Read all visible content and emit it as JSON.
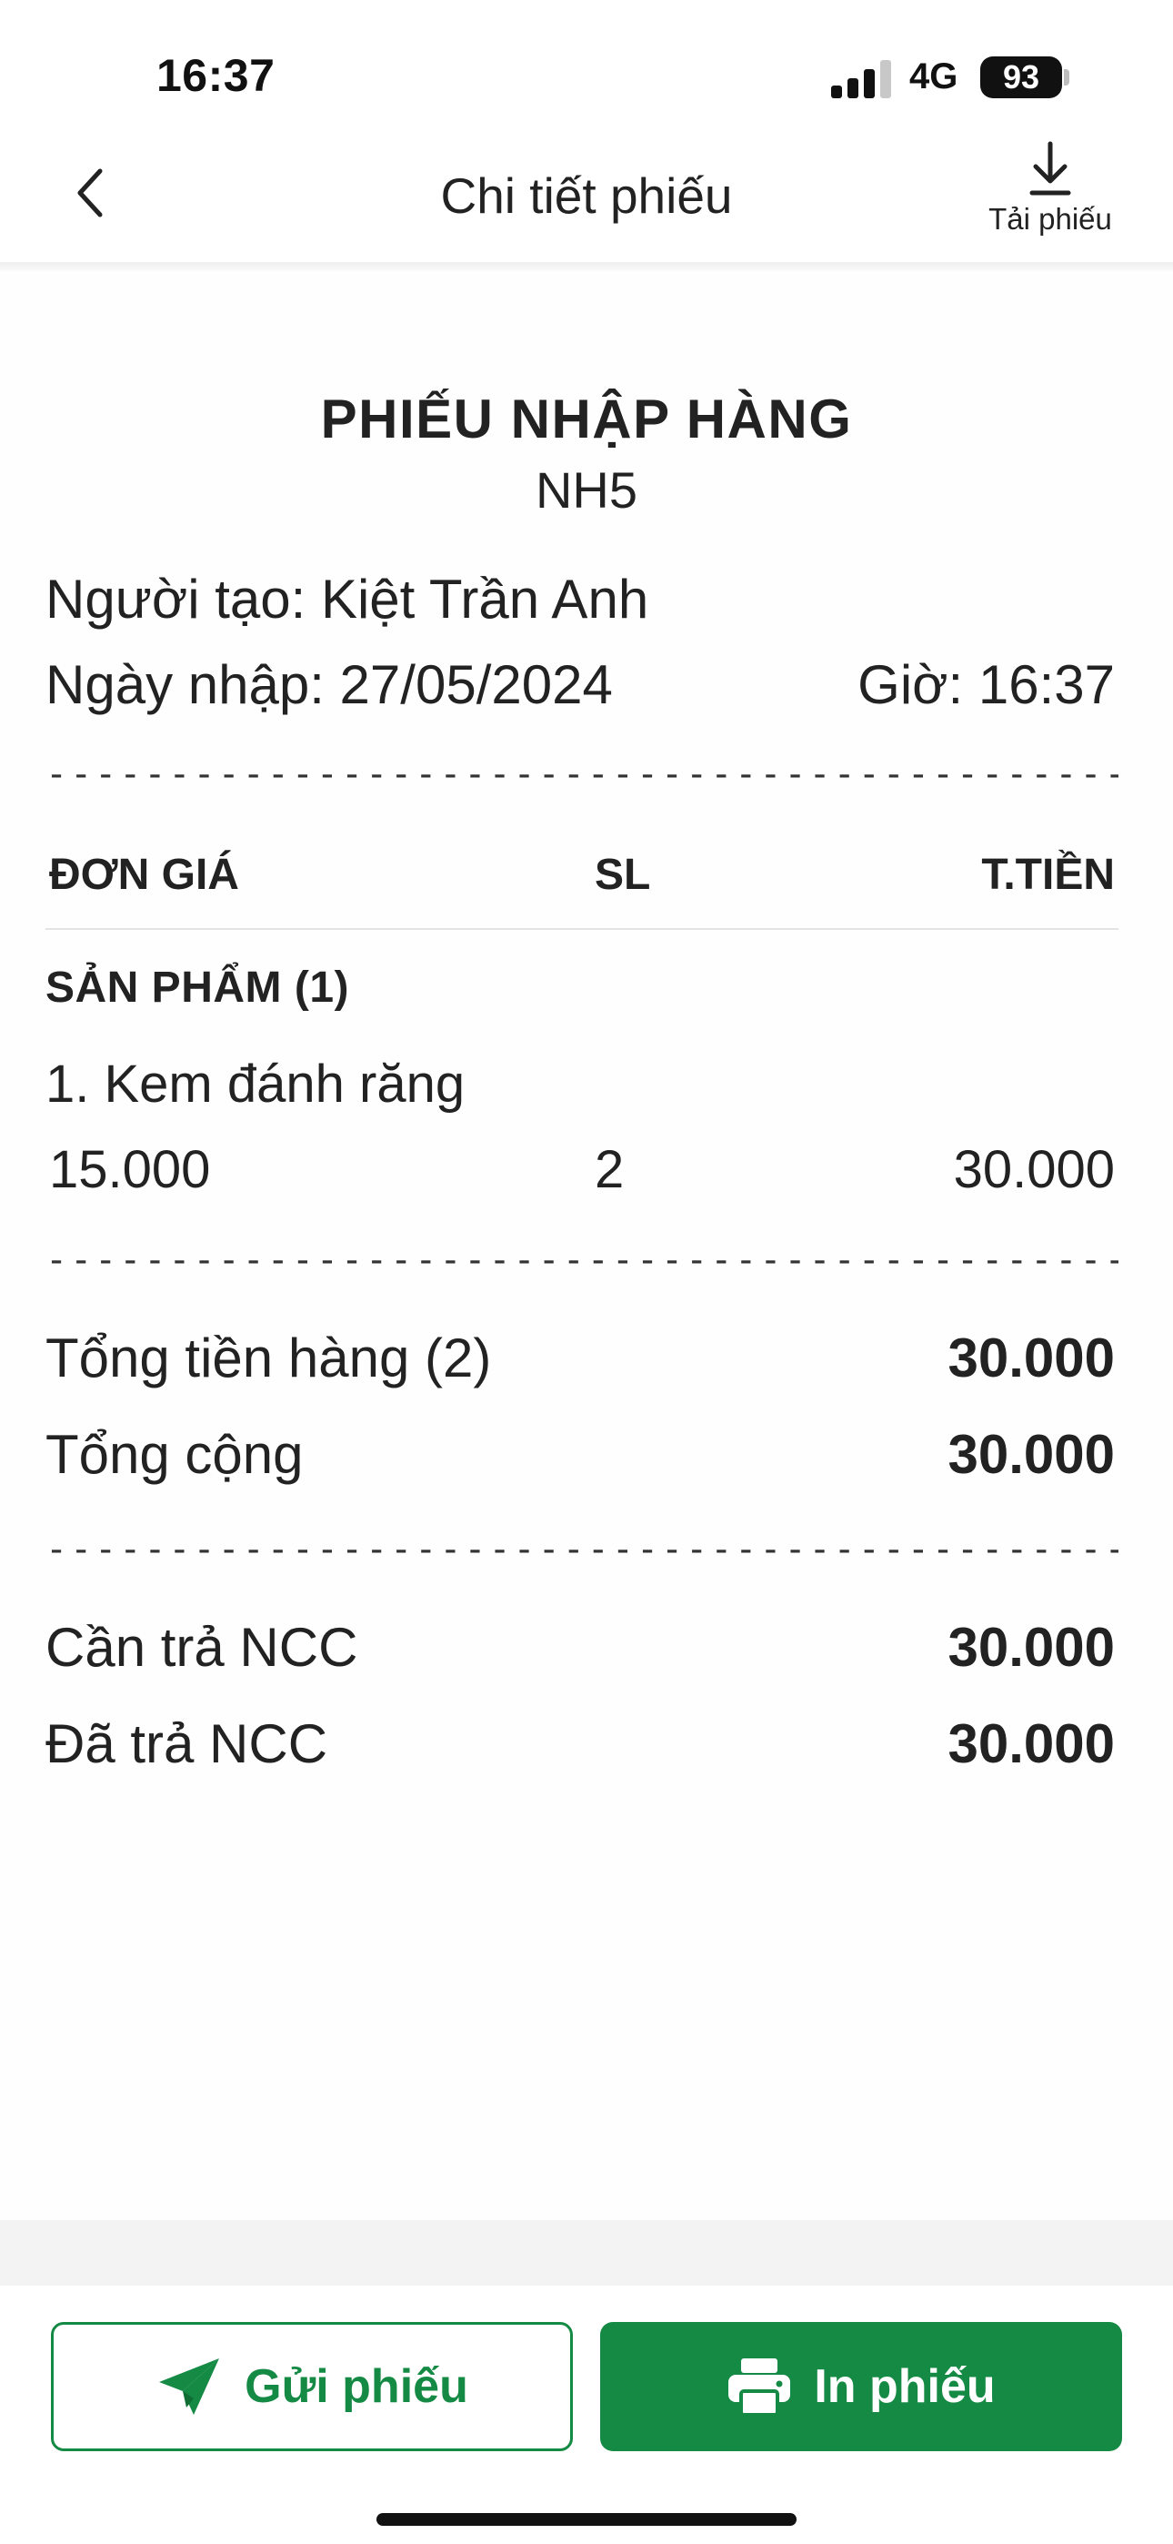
{
  "status_bar": {
    "time": "16:37",
    "network": "4G",
    "battery": "93"
  },
  "nav": {
    "title": "Chi tiết phiếu",
    "download_label": "Tải phiếu",
    "back_icon": "chevron-left-icon",
    "download_icon": "download-icon"
  },
  "receipt": {
    "title": "PHIẾU NHẬP HÀNG",
    "code": "NH5",
    "creator": "Người tạo: Kiệt Trần Anh",
    "date": "Ngày nhập: 27/05/2024",
    "time": "Giờ: 16:37",
    "dashes": "------------------------------------------------------------------",
    "columns": {
      "unit_price": "ĐƠN GIÁ",
      "quantity": "SL",
      "amount": "T.TIỀN"
    },
    "section_label": "SẢN PHẨM (1)",
    "items": [
      {
        "name": "1. Kem đánh răng",
        "unit_price": "15.000",
        "quantity": "2",
        "amount": "30.000"
      }
    ],
    "totals": [
      {
        "label": "Tổng tiền hàng (2)",
        "value": "30.000"
      },
      {
        "label": "Tổng cộng",
        "value": "30.000"
      }
    ],
    "payments": [
      {
        "label": "Cần trả NCC",
        "value": "30.000"
      },
      {
        "label": "Đã trả NCC",
        "value": "30.000"
      }
    ]
  },
  "footer": {
    "send_label": "Gửi phiếu",
    "print_label": "In phiếu",
    "send_icon": "paper-plane-icon",
    "print_icon": "printer-icon",
    "accent_color": "#158a44"
  }
}
